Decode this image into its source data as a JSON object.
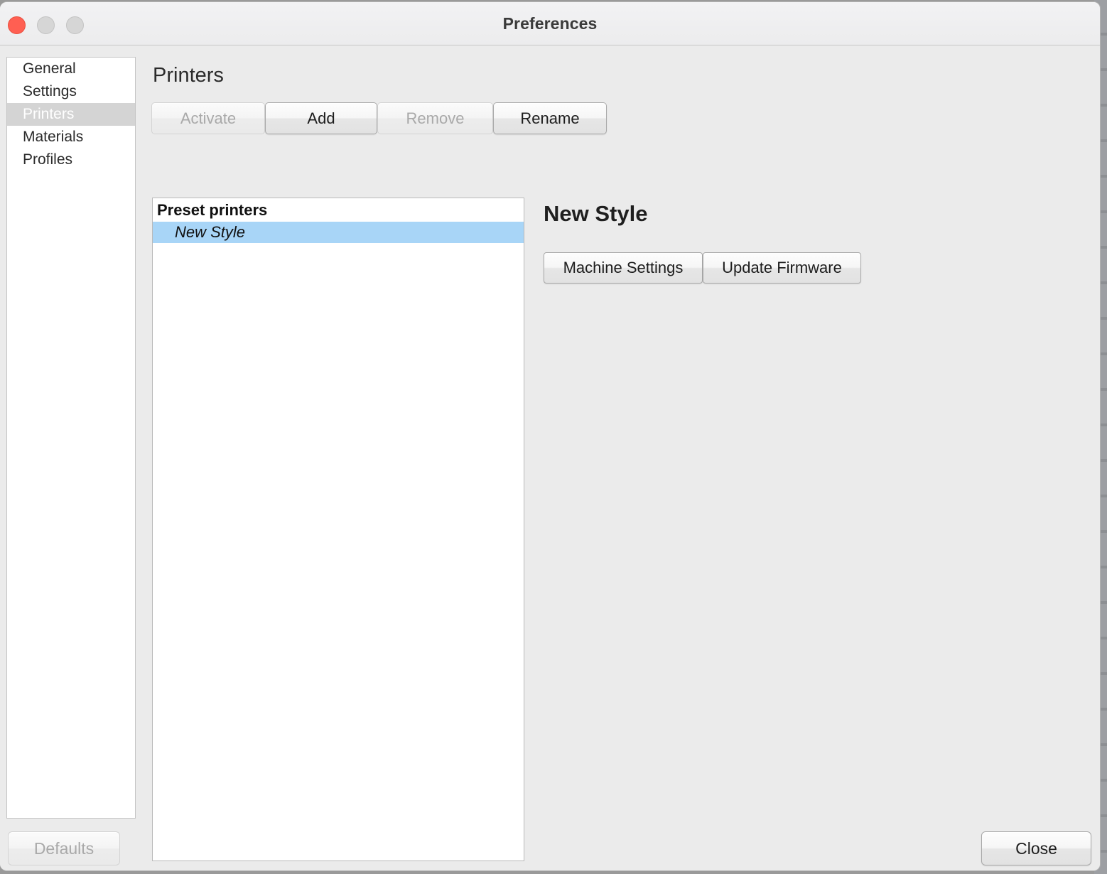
{
  "window": {
    "title": "Preferences",
    "traffic_lights": [
      {
        "name": "close",
        "color": "#ff5f52"
      },
      {
        "name": "minimize",
        "color": "#d6d6d6"
      },
      {
        "name": "maximize",
        "color": "#d6d6d6"
      }
    ]
  },
  "sidebar": {
    "items": [
      {
        "label": "General",
        "selected": false
      },
      {
        "label": "Settings",
        "selected": false
      },
      {
        "label": "Printers",
        "selected": true
      },
      {
        "label": "Materials",
        "selected": false
      },
      {
        "label": "Profiles",
        "selected": false
      }
    ]
  },
  "main": {
    "page_title": "Printers",
    "toolbar": {
      "activate_label": "Activate",
      "add_label": "Add",
      "remove_label": "Remove",
      "rename_label": "Rename"
    },
    "printer_list": {
      "group_label": "Preset printers",
      "rows": [
        {
          "label": "New Style",
          "selected": true
        }
      ]
    },
    "detail": {
      "title": "New Style",
      "machine_settings_label": "Machine Settings",
      "update_firmware_label": "Update Firmware"
    }
  },
  "footer": {
    "defaults_label": "Defaults",
    "close_label": "Close"
  },
  "colors": {
    "titlebar_bg": "#ececed",
    "content_bg": "#ebebeb",
    "panel_bg": "#ffffff",
    "selection_blue": "#a8d5f7",
    "sidebar_selection_gray": "#d4d4d4",
    "disabled_text": "#a9a9a9"
  }
}
